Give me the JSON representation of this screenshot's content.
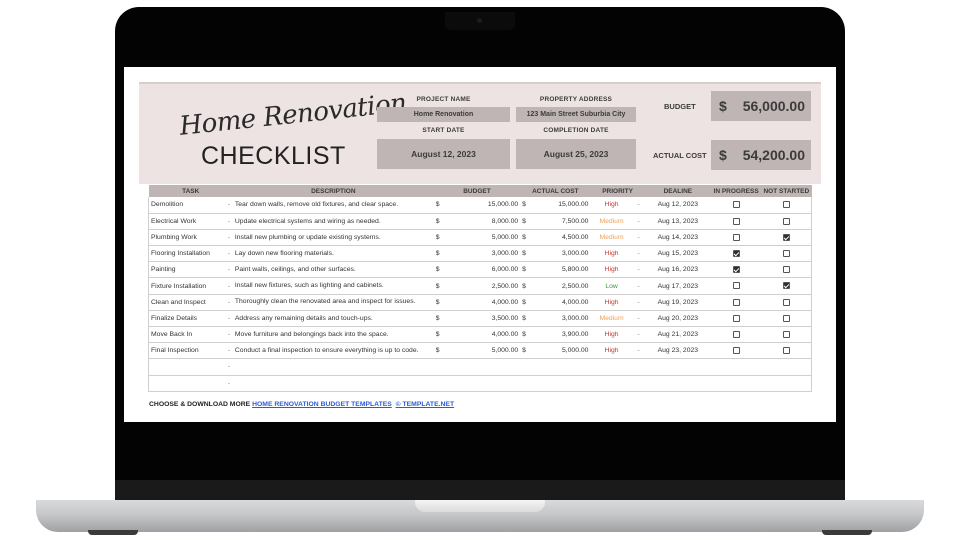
{
  "header": {
    "title_script": "Home Renovation",
    "title_main": "CHECKLIST",
    "project_name_label": "PROJECT NAME",
    "project_name": "Home Renovation",
    "property_address_label": "PROPERTY ADDRESS",
    "property_address": "123 Main Street Suburbia City",
    "start_date_label": "START DATE",
    "start_date": "August 12, 2023",
    "completion_date_label": "COMPLETION DATE",
    "completion_date": "August 25, 2023",
    "budget_label": "BUDGET",
    "budget_currency": "$",
    "budget_value": "56,000.00",
    "actual_cost_label": "ACTUAL COST",
    "actual_cost_currency": "$",
    "actual_cost_value": "54,200.00"
  },
  "table": {
    "columns": [
      "TASK",
      "DESCRIPTION",
      "BUDGET",
      "ACTUAL COST",
      "PRIORITY",
      "DEALINE",
      "IN PROGRESS",
      "NOT STARTED"
    ],
    "rows": [
      {
        "task": "Demolition",
        "dash": "-",
        "description": "Tear down walls, remove old fixtures, and clear space.",
        "cur1": "$",
        "budget": "15,000.00",
        "cur2": "$",
        "actual": "15,000.00",
        "priority": "High",
        "pdash": "-",
        "deadline": "Aug 12, 2023",
        "in_progress": false,
        "not_started": false
      },
      {
        "task": "Electrical Work",
        "dash": "-",
        "description": "Update electrical systems and wiring as needed.",
        "cur1": "$",
        "budget": "8,000.00",
        "cur2": "$",
        "actual": "7,500.00",
        "priority": "Medium",
        "pdash": "-",
        "deadline": "Aug 13, 2023",
        "in_progress": false,
        "not_started": false
      },
      {
        "task": "Plumbing Work",
        "dash": "-",
        "description": "Install new plumbing or update existing systems.",
        "cur1": "$",
        "budget": "5,000.00",
        "cur2": "$",
        "actual": "4,500.00",
        "priority": "Medium",
        "pdash": "-",
        "deadline": "Aug 14, 2023",
        "in_progress": false,
        "not_started": true
      },
      {
        "task": "Flooring Installation",
        "dash": "-",
        "description": "Lay down new flooring materials.",
        "cur1": "$",
        "budget": "3,000.00",
        "cur2": "$",
        "actual": "3,000.00",
        "priority": "High",
        "pdash": "-",
        "deadline": "Aug 15, 2023",
        "in_progress": true,
        "not_started": false
      },
      {
        "task": "Painting",
        "dash": "-",
        "description": "Paint walls, ceilings, and other surfaces.",
        "cur1": "$",
        "budget": "6,000.00",
        "cur2": "$",
        "actual": "5,800.00",
        "priority": "High",
        "pdash": "-",
        "deadline": "Aug 16, 2023",
        "in_progress": true,
        "not_started": false
      },
      {
        "task": "Fixture Installation",
        "dash": "-",
        "description": "Install new fixtures, such as lighting and cabinets.",
        "cur1": "$",
        "budget": "2,500.00",
        "cur2": "$",
        "actual": "2,500.00",
        "priority": "Low",
        "pdash": "-",
        "deadline": "Aug 17, 2023",
        "in_progress": false,
        "not_started": true
      },
      {
        "task": "Clean and Inspect",
        "dash": "-",
        "description": "Thoroughly clean the renovated area and inspect for issues.",
        "cur1": "$",
        "budget": "4,000.00",
        "cur2": "$",
        "actual": "4,000.00",
        "priority": "High",
        "pdash": "-",
        "deadline": "Aug 19, 2023",
        "in_progress": false,
        "not_started": false
      },
      {
        "task": "Finalize Details",
        "dash": "-",
        "description": "Address any remaining details and touch-ups.",
        "cur1": "$",
        "budget": "3,500.00",
        "cur2": "$",
        "actual": "3,000.00",
        "priority": "Medium",
        "pdash": "-",
        "deadline": "Aug 20, 2023",
        "in_progress": false,
        "not_started": false
      },
      {
        "task": "Move Back In",
        "dash": "-",
        "description": "Move furniture and belongings back into the space.",
        "cur1": "$",
        "budget": "4,000.00",
        "cur2": "$",
        "actual": "3,900.00",
        "priority": "High",
        "pdash": "-",
        "deadline": "Aug 21, 2023",
        "in_progress": false,
        "not_started": false
      },
      {
        "task": "Final Inspection",
        "dash": "-",
        "description": "Conduct a final inspection to ensure everything is up to code.",
        "cur1": "$",
        "budget": "5,000.00",
        "cur2": "$",
        "actual": "5,000.00",
        "priority": "High",
        "pdash": "-",
        "deadline": "Aug 23, 2023",
        "in_progress": false,
        "not_started": false
      },
      {
        "task": "",
        "dash": "-",
        "description": "",
        "cur1": "",
        "budget": "",
        "cur2": "",
        "actual": "",
        "priority": "",
        "pdash": "",
        "deadline": "",
        "in_progress": null,
        "not_started": null
      },
      {
        "task": "",
        "dash": "-",
        "description": "",
        "cur1": "",
        "budget": "",
        "cur2": "",
        "actual": "",
        "priority": "",
        "pdash": "",
        "deadline": "",
        "in_progress": null,
        "not_started": null
      }
    ]
  },
  "footer": {
    "prefix": "CHOOSE & DOWNLOAD MORE ",
    "link1": "HOME RENOVATION BUDGET TEMPLATES",
    "link2": "© TEMPLATE.NET"
  },
  "colors": {
    "header_bg": "#ece3e2",
    "field_bg": "#bfb5b4",
    "priority_high": "#c0392b",
    "priority_medium": "#f0a35a",
    "priority_low": "#3a9a3a",
    "link": "#2b5bd7"
  }
}
